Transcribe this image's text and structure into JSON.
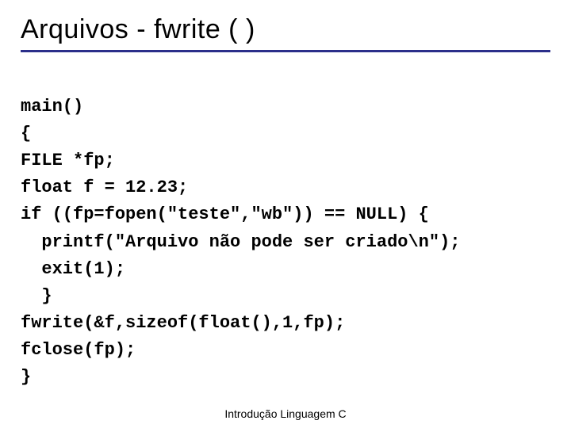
{
  "title": "Arquivos - fwrite ( )",
  "code": {
    "l1": "main()",
    "l2": "{",
    "l3": "FILE *fp;",
    "l4": "float f = 12.23;",
    "l5": "if ((fp=fopen(\"teste\",\"wb\")) == NULL) {",
    "l6": "  printf(\"Arquivo não pode ser criado\\n\");",
    "l7": "  exit(1);",
    "l8": "  }",
    "l9": "fwrite(&f,sizeof(float(),1,fp);",
    "l10": "fclose(fp);",
    "l11": "}"
  },
  "footer": "Introdução Linguagem C"
}
